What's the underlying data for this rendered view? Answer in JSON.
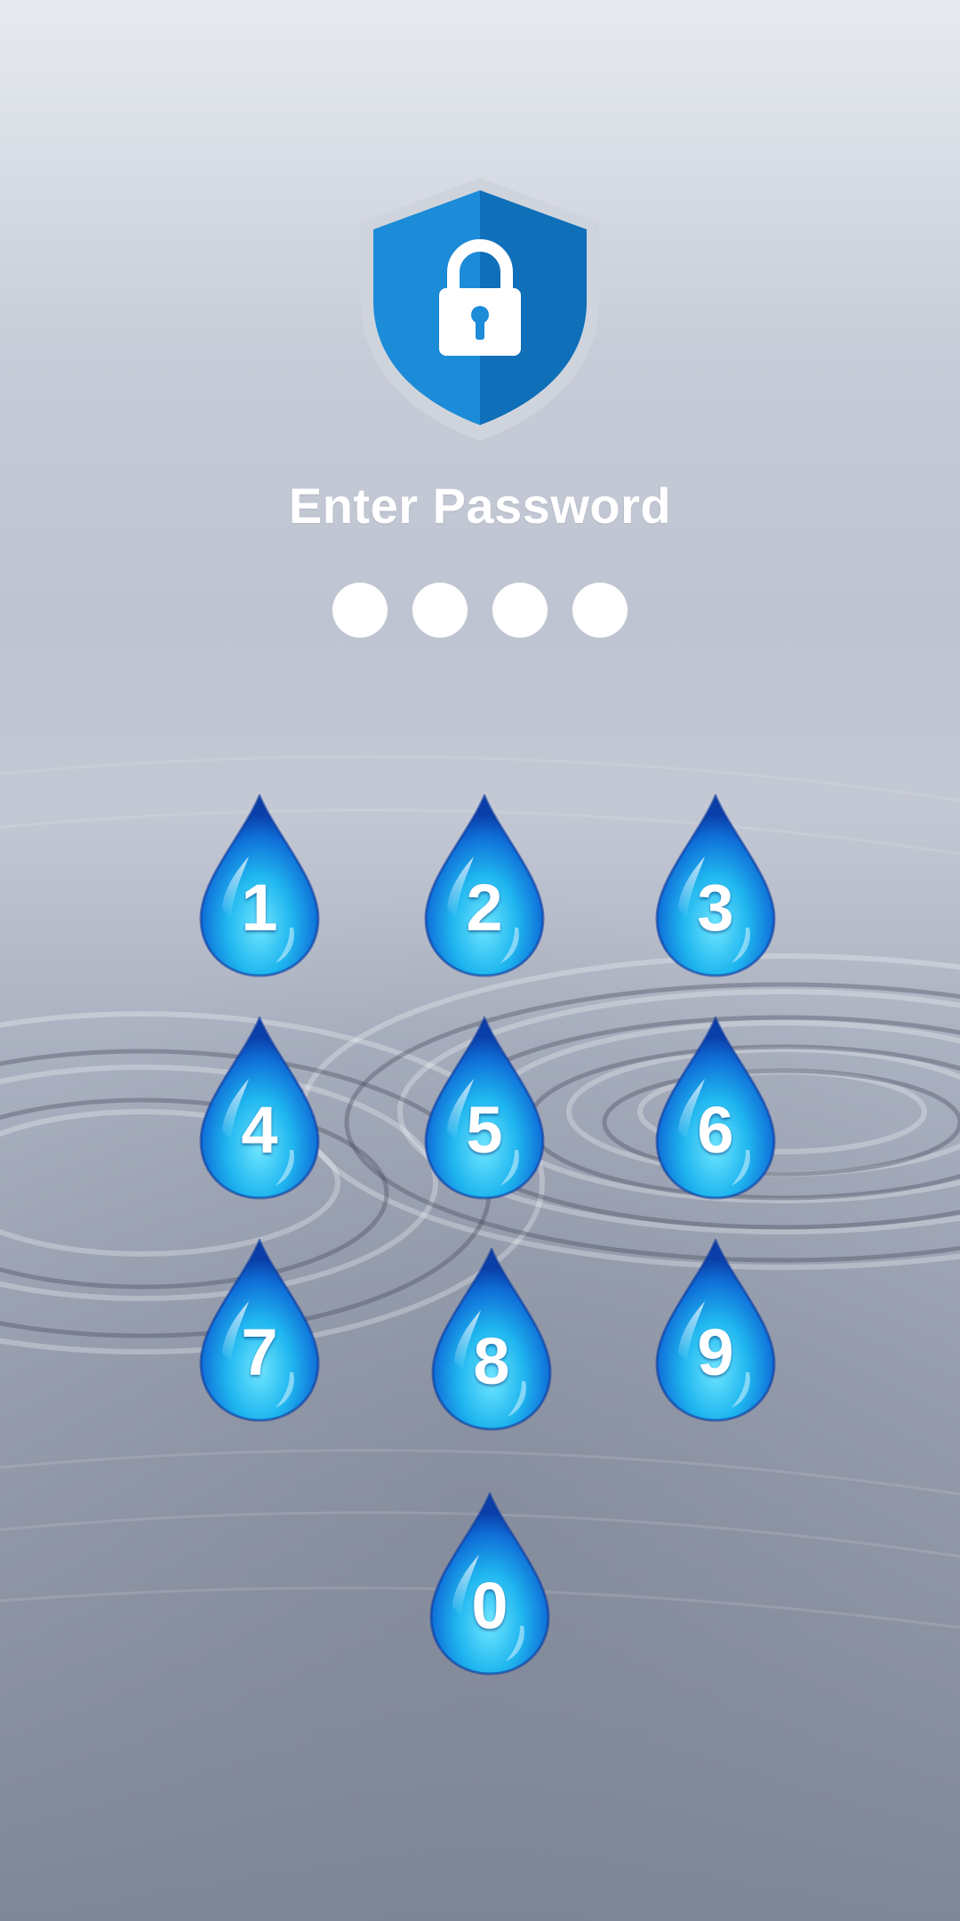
{
  "screen": {
    "title": "Enter Password"
  },
  "pin": {
    "length": 4,
    "entered": 0
  },
  "keypad": {
    "keys": [
      "1",
      "2",
      "3",
      "4",
      "5",
      "6",
      "7",
      "8",
      "9",
      "0"
    ]
  },
  "icons": {
    "header": "shield-lock-icon",
    "key": "water-drop-icon"
  },
  "colors": {
    "shield_blue": "#1c8bd8",
    "shield_dark": "#0f6fb8",
    "drop_light": "#27c8f5",
    "drop_dark": "#0c3fb5",
    "text": "#ffffff"
  }
}
